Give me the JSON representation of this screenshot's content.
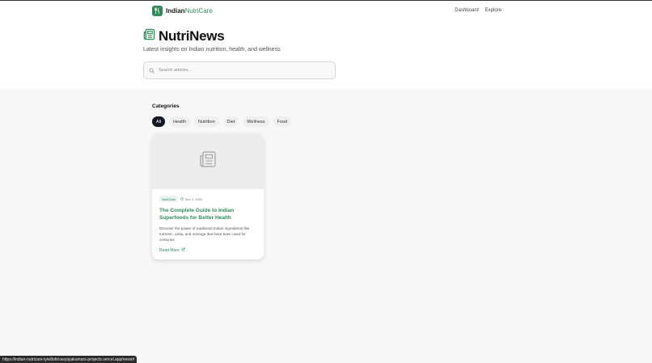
{
  "brand": {
    "name_part1": "Indian",
    "name_part2": "NutriCare"
  },
  "nav": {
    "dashboard": "Dashboard",
    "explore": "Explore"
  },
  "page": {
    "title": "NutriNews",
    "subtitle": "Latest insights on Indian nutrition, health, and wellness"
  },
  "search": {
    "placeholder": "Search articles...",
    "value": ""
  },
  "categories": {
    "heading": "Categories",
    "items": [
      "All",
      "Health",
      "Nutrition",
      "Diet",
      "Wellness",
      "Food"
    ],
    "selected": "All"
  },
  "articles": [
    {
      "source": "NutriCare",
      "date": "Dec 1, 2025",
      "title": "The Complete Guide to Indian Superfoods for Better Health",
      "description": "Discover the power of traditional Indian ingredients like turmeric, amla, and moringa that have been used for centuries.",
      "link_label": "Read More"
    }
  ],
  "status_bar": {
    "url": "https://indian-nutricare-iyre8ofsl-avyayakumars-projects.vercel.app/news#"
  },
  "colors": {
    "accent": "#2f8a5c",
    "chip_active": "#141923"
  },
  "icons": {
    "logo": "utensils-icon",
    "title": "newspaper-icon",
    "search": "search-icon",
    "date": "clock-icon",
    "link": "external-link-icon"
  }
}
